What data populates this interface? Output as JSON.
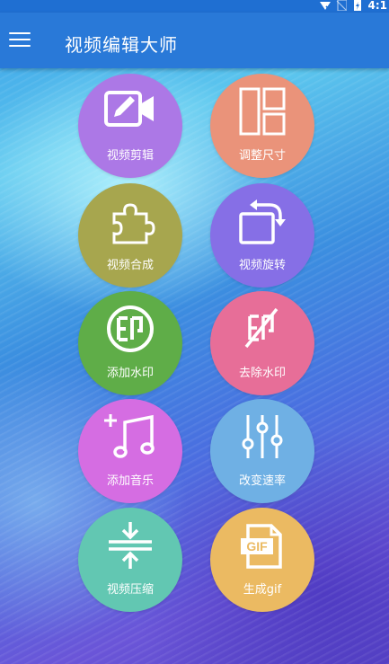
{
  "status_bar": {
    "time": "4:1"
  },
  "app_bar": {
    "title": "视频编辑大师",
    "menu_icon": "hamburger-menu-icon"
  },
  "features": [
    {
      "label": "视频剪辑",
      "icon": "video-edit-icon",
      "color": "#ac78e6"
    },
    {
      "label": "调整尺寸",
      "icon": "resize-layout-icon",
      "color": "#ea937a"
    },
    {
      "label": "视频合成",
      "icon": "puzzle-piece-icon",
      "color": "#a7a64e"
    },
    {
      "label": "视频旋转",
      "icon": "rotate-icon",
      "color": "#866fe6"
    },
    {
      "label": "添加水印",
      "icon": "watermark-seal-icon",
      "color": "#5fad48"
    },
    {
      "label": "去除水印",
      "icon": "remove-watermark-icon",
      "color": "#e76e98"
    },
    {
      "label": "添加音乐",
      "icon": "add-music-icon",
      "color": "#d56de2"
    },
    {
      "label": "改变速率",
      "icon": "speed-sliders-icon",
      "color": "#6fb0e4"
    },
    {
      "label": "视频压缩",
      "icon": "compress-icon",
      "color": "#62c7b2"
    },
    {
      "label": "生成gif",
      "icon": "gif-file-icon",
      "color": "#ebba62"
    }
  ]
}
